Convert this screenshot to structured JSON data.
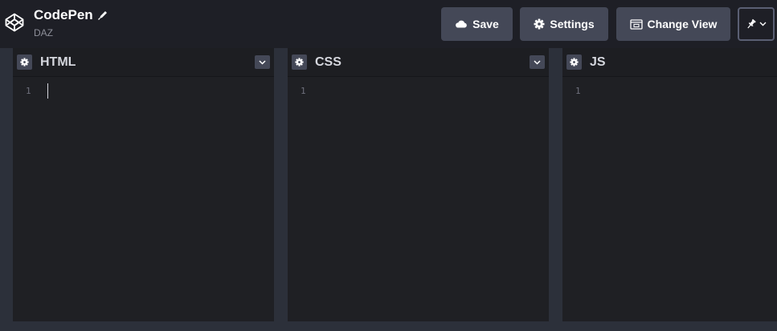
{
  "header": {
    "app_name": "CodePen",
    "owner": "DAZ",
    "save_label": "Save",
    "settings_label": "Settings",
    "change_view_label": "Change View",
    "icons": {
      "logo": "codepen-logo-icon",
      "edit": "pencil-icon",
      "save": "cloud-icon",
      "settings": "gear-icon",
      "change_view": "layout-icon",
      "pin": "pin-icon",
      "dropdown": "chevron-down-icon"
    }
  },
  "editors": [
    {
      "title": "HTML",
      "line": "1"
    },
    {
      "title": "CSS",
      "line": "1"
    },
    {
      "title": "JS",
      "line": "1"
    }
  ],
  "colors": {
    "background": "#1d1e22",
    "header": "#1e1f26",
    "button": "#444857",
    "gutter": "#2c303a"
  }
}
